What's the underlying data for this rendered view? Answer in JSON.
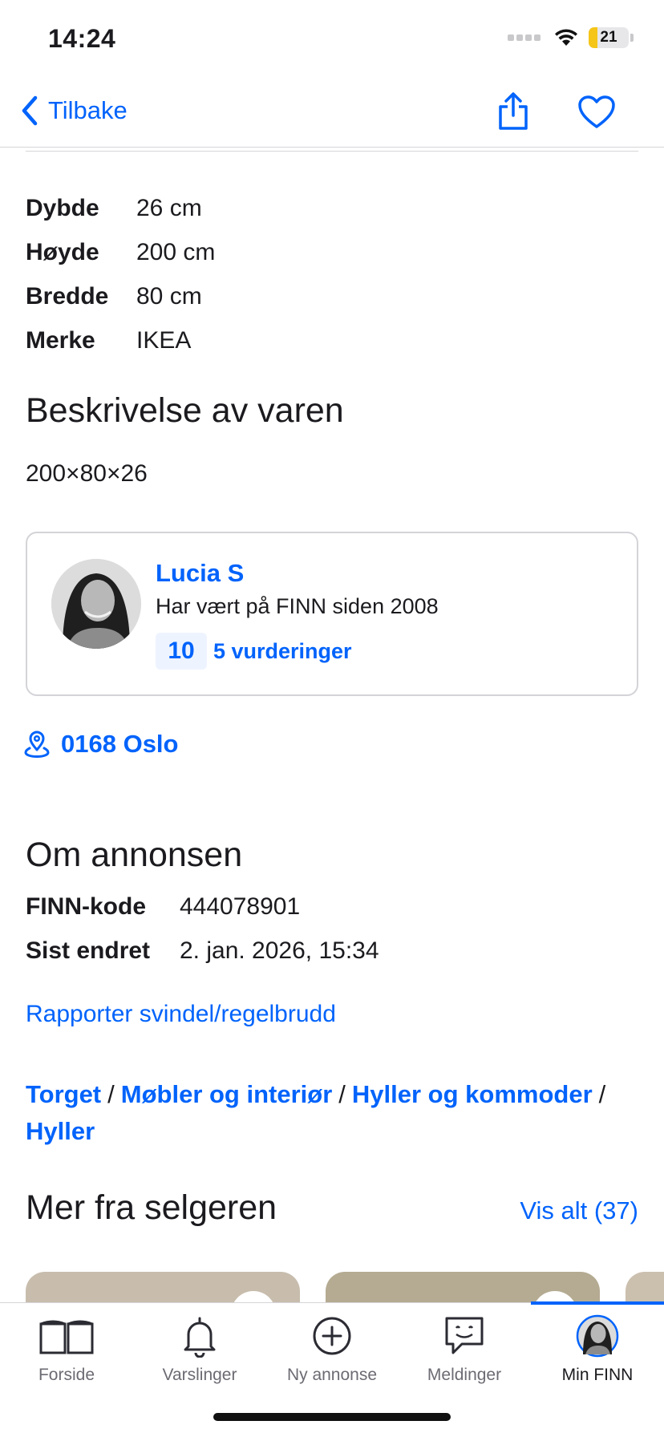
{
  "status_bar": {
    "time": "14:24",
    "battery_level": "21",
    "battery_fraction": 0.21,
    "battery_color": "#f5c518"
  },
  "nav": {
    "back_label": "Tilbake",
    "share_icon": "share-icon",
    "favorite_icon": "heart-icon"
  },
  "specs": [
    {
      "key": "Dybde",
      "value": "26 cm"
    },
    {
      "key": "Høyde",
      "value": "200 cm"
    },
    {
      "key": "Bredde",
      "value": "80 cm"
    },
    {
      "key": "Merke",
      "value": "IKEA"
    }
  ],
  "description": {
    "title": "Beskrivelse av varen",
    "text": "200×80×26"
  },
  "seller": {
    "name": "Lucia S",
    "since": "Har vært på FINN siden 2008",
    "rating_score": "10",
    "rating_count": "5 vurderinger"
  },
  "location": {
    "text": "0168 Oslo",
    "icon": "location-pin-icon"
  },
  "about": {
    "title": "Om annonsen",
    "rows": [
      {
        "key": "FINN-kode",
        "value": "444078901"
      },
      {
        "key": "Sist endret",
        "value": "2. jan. 2026, 15:34"
      }
    ],
    "report_link": "Rapporter svindel/regelbrudd"
  },
  "breadcrumb": [
    "Torget",
    "Møbler og interiør",
    "Hyller og kommoder",
    "Hyller"
  ],
  "more_from_seller": {
    "title": "Mer fra selgeren",
    "see_all": "Vis alt (37)"
  },
  "tab_bar": {
    "tabs": [
      {
        "label": "Forside",
        "icon": "book-icon"
      },
      {
        "label": "Varslinger",
        "icon": "bell-icon"
      },
      {
        "label": "Ny annonse",
        "icon": "plus-circle-icon"
      },
      {
        "label": "Meldinger",
        "icon": "chat-icon"
      },
      {
        "label": "Min FINN",
        "icon": "avatar-icon"
      }
    ],
    "active_index": 4
  },
  "colors": {
    "accent": "#0063fb",
    "text": "#1b1b1f",
    "border": "#d3d3d8"
  }
}
